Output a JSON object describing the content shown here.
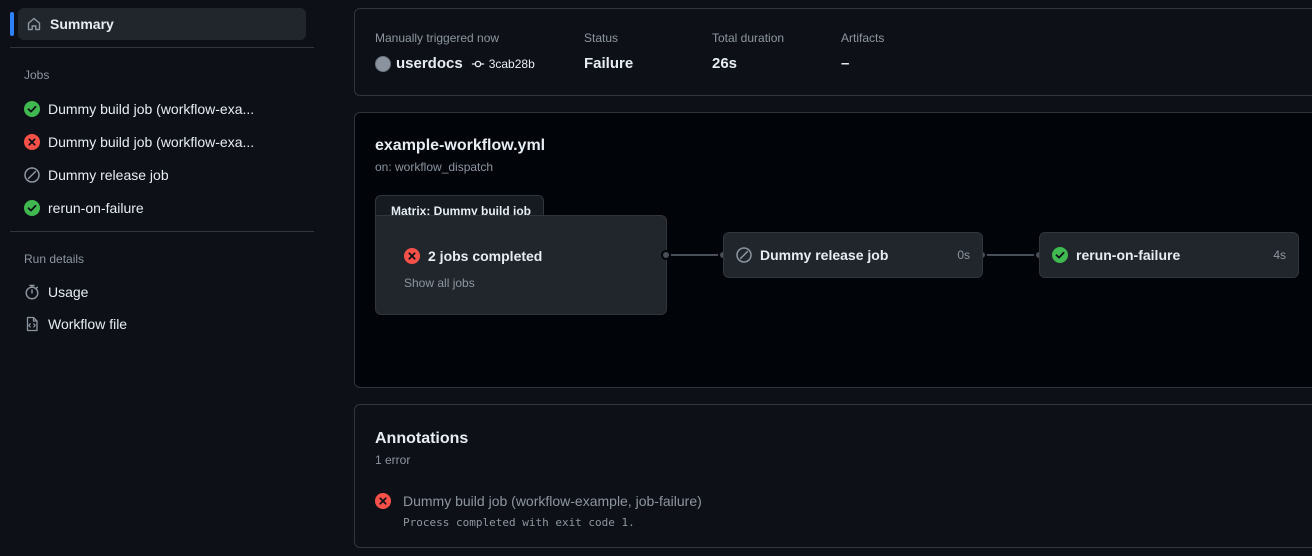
{
  "sidebar": {
    "summary_label": "Summary",
    "jobs_section": "Jobs",
    "jobs": [
      {
        "label": "Dummy build job (workflow-exa...",
        "status": "success"
      },
      {
        "label": "Dummy build job (workflow-exa...",
        "status": "failure"
      },
      {
        "label": "Dummy release job",
        "status": "skipped"
      },
      {
        "label": "rerun-on-failure",
        "status": "success"
      }
    ],
    "run_details_section": "Run details",
    "run_details": [
      {
        "label": "Usage",
        "icon": "stopwatch-icon"
      },
      {
        "label": "Workflow file",
        "icon": "file-code-icon"
      }
    ]
  },
  "meta": {
    "trigger_label": "Manually triggered now",
    "user": "userdocs",
    "commit": "3cab28b",
    "status_label": "Status",
    "status_value": "Failure",
    "duration_label": "Total duration",
    "duration_value": "26s",
    "artifacts_label": "Artifacts",
    "artifacts_value": "–"
  },
  "graph": {
    "workflow_file": "example-workflow.yml",
    "trigger": "on: workflow_dispatch",
    "matrix_label": "Matrix: Dummy build job",
    "matrix_status": "2 jobs completed",
    "show_all": "Show all jobs",
    "nodes": [
      {
        "label": "Dummy release job",
        "duration": "0s",
        "status": "skipped"
      },
      {
        "label": "rerun-on-failure",
        "duration": "4s",
        "status": "success"
      }
    ]
  },
  "annotations": {
    "title": "Annotations",
    "count": "1 error",
    "items": [
      {
        "job": "Dummy build job (workflow-example, job-failure)",
        "message": "Process completed with exit code 1."
      }
    ]
  },
  "colors": {
    "success": "#3fb950",
    "failure": "#f85149",
    "accent": "#2f81f7",
    "muted": "#8d96a0"
  }
}
